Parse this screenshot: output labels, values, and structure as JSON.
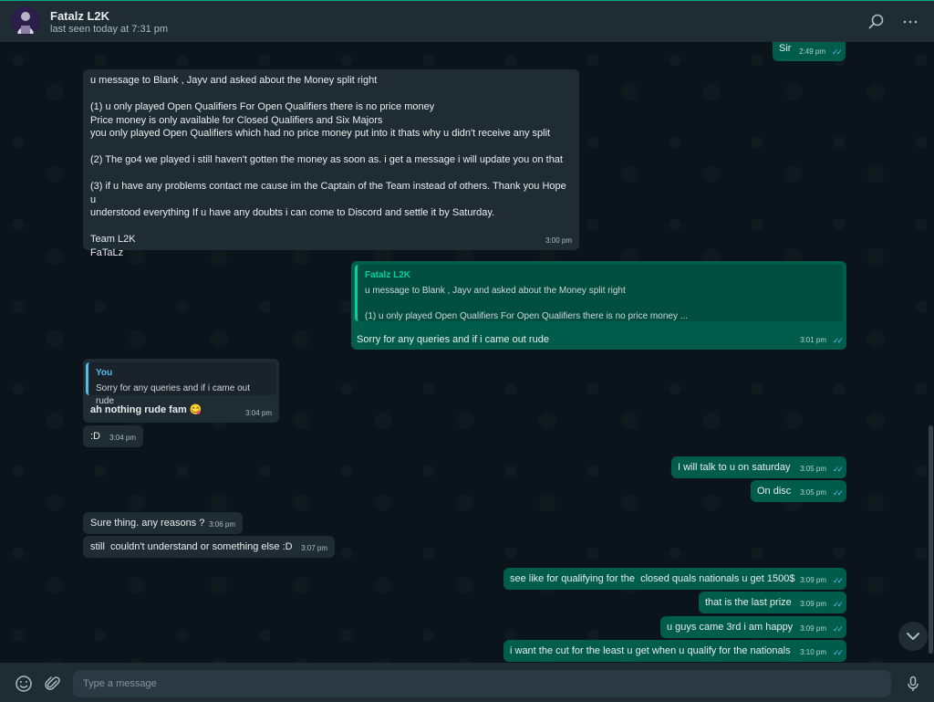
{
  "header": {
    "contact_name": "Fatalz L2K",
    "last_seen": "last seen today at 7:31 pm",
    "icons": [
      "search-icon",
      "menu-icon"
    ]
  },
  "messages": [
    {
      "id": "m0",
      "direction": "out",
      "text": "Sir",
      "time": "2:49 pm",
      "read": true
    },
    {
      "id": "m1",
      "direction": "in",
      "text": "u message to Blank , Jayv and asked about the Money split right\n\n(1) u only played Open Qualifiers For Open Qualifiers there is no price money\nPrice money is only available for Closed Qualifiers and Six Majors\nyou only played Open Qualifiers which had no price money put into it thats why u didn't receive any split\n\n(2) The go4 we played i still haven't gotten the money as soon as. i get a message i will update you on that\n\n(3) if u have any problems contact me cause im the Captain of the Team instead of others. Thank you Hope u\nunderstood everything If u have any doubts i can come to Discord and settle it by Saturday.\n\nTeam L2K\nFaTaLz",
      "time": "3:00 pm"
    },
    {
      "id": "m2",
      "direction": "out",
      "quote_name": "Fatalz L2K",
      "quote_text": "u message to Blank , Jayv and asked about the Money split right\n\n(1) u only played Open Qualifiers For Open Qualifiers there is no price money ...",
      "text": "Sorry for any queries and if i came out rude",
      "time": "3:01 pm",
      "read": true
    },
    {
      "id": "m3",
      "direction": "in",
      "quote_name": "You",
      "quote_text": "Sorry for any queries and if i came out rude",
      "text": "ah nothing rude fam",
      "emoji": "😋",
      "time": "3:04 pm"
    },
    {
      "id": "m4",
      "direction": "in",
      "text": ":D",
      "time": "3:04 pm"
    },
    {
      "id": "m5",
      "direction": "out",
      "text": "I will talk to u on saturday",
      "time": "3:05 pm",
      "read": true
    },
    {
      "id": "m6",
      "direction": "out",
      "text": "On disc",
      "time": "3:05 pm",
      "read": true
    },
    {
      "id": "m7",
      "direction": "in",
      "text": "Sure thing. any reasons ?",
      "time": "3:06 pm"
    },
    {
      "id": "m8",
      "direction": "in",
      "text": "still  couldn't understand or something else :D",
      "time": "3:07 pm"
    },
    {
      "id": "m9",
      "direction": "out",
      "text": "see like for qualifying for the  closed quals nationals u get 1500$",
      "time": "3:09 pm",
      "read": true
    },
    {
      "id": "m10",
      "direction": "out",
      "text": "that is the last prize",
      "time": "3:09 pm",
      "read": true
    },
    {
      "id": "m11",
      "direction": "out",
      "text": "u guys came 3rd i am happy",
      "time": "3:09 pm",
      "read": true
    },
    {
      "id": "m12",
      "direction": "out",
      "text": "i want the cut for the least u get when u qualify for the nationals",
      "time": "3:10 pm",
      "read": true
    }
  ],
  "composer": {
    "placeholder": "Type a message",
    "icons": [
      "emoji-icon",
      "attach-icon",
      "mic-icon"
    ]
  },
  "colors": {
    "background": "#0b141a",
    "panel": "#202c33",
    "incoming_bubble": "#202c33",
    "outgoing_bubble": "#005c4b",
    "accent": "#00a884",
    "read_ticks": "#53bdeb"
  }
}
